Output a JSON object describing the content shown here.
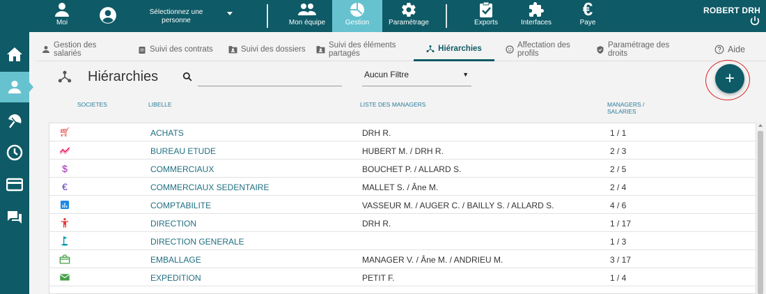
{
  "topbar": {
    "moi": "Moi",
    "person_select": "Sélectionnez une personne",
    "mon_equipe": "Mon équipe",
    "gestion": "Gestion",
    "parametrage": "Paramétrage",
    "exports": "Exports",
    "interfaces": "Interfaces",
    "paye": "Paye",
    "user_name": "ROBERT DRH"
  },
  "subtabs": [
    {
      "label": "Gestion des salariés"
    },
    {
      "label": "Suivi des contrats"
    },
    {
      "label": "Suivi des dossiers"
    },
    {
      "label": "Suivi des éléments partagés"
    },
    {
      "label": "Hiérarchies"
    },
    {
      "label": "Affectation des profils"
    },
    {
      "label": "Paramétrage des droits"
    },
    {
      "label": "Aide"
    }
  ],
  "page": {
    "title": "Hiérarchies",
    "search_placeholder": "",
    "filter_value": "Aucun Filtre",
    "add_label": "+"
  },
  "columns": {
    "societes": "SOCIETES",
    "libelle": "LIBELLE",
    "managers": "LISTE DES MANAGERS",
    "ratio": "MANAGERS / SALARIES"
  },
  "rows": [
    {
      "icon": "cart-icon",
      "color": "#e53935",
      "libelle": "ACHATS",
      "managers": "DRH R.",
      "ratio": "1 / 1"
    },
    {
      "icon": "trend-icon",
      "color": "#e91e63",
      "libelle": "BUREAU ETUDE",
      "managers": "HUBERT M. / DRH R.",
      "ratio": "2 / 3"
    },
    {
      "icon": "dollar-icon",
      "color": "#9c27b0",
      "libelle": "COMMERCIAUX",
      "managers": "BOUCHET P. / ALLARD S.",
      "ratio": "2 / 5"
    },
    {
      "icon": "euro-icon",
      "color": "#5c3bb8",
      "libelle": "COMMERCIAUX SEDENTAIRE",
      "managers": "MALLET S. / Âne M.",
      "ratio": "2 / 4"
    },
    {
      "icon": "chart-icon",
      "color": "#1e88e5",
      "libelle": "COMPTABILITE",
      "managers": "VASSEUR M. / AUGER C. / BAILLY S. / ALLARD S.",
      "ratio": "4 / 6"
    },
    {
      "icon": "person-icon",
      "color": "#e53935",
      "libelle": "DIRECTION",
      "managers": "DRH R.",
      "ratio": "1 / 17"
    },
    {
      "icon": "golf-icon",
      "color": "#0097a7",
      "libelle": "DIRECTION GENERALE",
      "managers": "",
      "ratio": "1 / 3"
    },
    {
      "icon": "package-icon",
      "color": "#43a047",
      "libelle": "EMBALLAGE",
      "managers": "MANAGER V. / Âne M. / ANDRIEU M.",
      "ratio": "3 / 17"
    },
    {
      "icon": "mail-icon",
      "color": "#43a047",
      "libelle": "EXPEDITION",
      "managers": "PETIT F.",
      "ratio": "1 / 4"
    }
  ],
  "colors": {
    "primary": "#0e5a66",
    "active": "#66c2cf"
  }
}
